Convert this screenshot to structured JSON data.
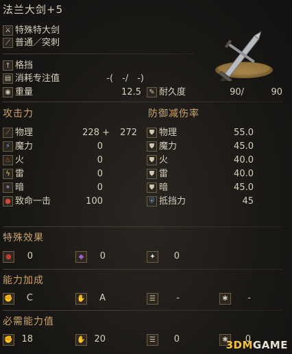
{
  "weapon_name": "法兰大剑+5",
  "weapon_type": "特殊特大剑",
  "attack_type": "普通／突刺",
  "skill": "格挡",
  "fp_cost_label": "消耗专注值",
  "fp_cost_value": "-(　-/　-)",
  "weight_label": "重量",
  "weight_value": "12.5",
  "durability_label": "耐久度",
  "durability_current": "90/",
  "durability_max": "90",
  "attack_header": "攻击力",
  "defense_header": "防御减伤率",
  "attack": [
    {
      "label": "物理",
      "value": "228 +",
      "extra": "272"
    },
    {
      "label": "魔力",
      "value": "0"
    },
    {
      "label": "火",
      "value": "0"
    },
    {
      "label": "雷",
      "value": "0"
    },
    {
      "label": "暗",
      "value": "0"
    },
    {
      "label": "致命一击",
      "value": "100"
    }
  ],
  "defense": [
    {
      "label": "物理",
      "value": "55.0"
    },
    {
      "label": "魔力",
      "value": "45.0"
    },
    {
      "label": "火",
      "value": "40.0"
    },
    {
      "label": "雷",
      "value": "40.0"
    },
    {
      "label": "暗",
      "value": "45.0"
    },
    {
      "label": "抵挡力",
      "value": "45"
    }
  ],
  "effects_header": "特殊效果",
  "effects": [
    "0",
    "0",
    "0"
  ],
  "scaling_header": "能力加成",
  "scaling": [
    "C",
    "A",
    "-",
    "-"
  ],
  "requirements_header": "必需能力值",
  "requirements": [
    "18",
    "20",
    "0",
    "0"
  ],
  "watermark": {
    "a": "3DM",
    "b": "GAME"
  },
  "colors": {
    "header": "#c9a36a",
    "text": "#d8d0bc",
    "background": "#1b1916"
  }
}
